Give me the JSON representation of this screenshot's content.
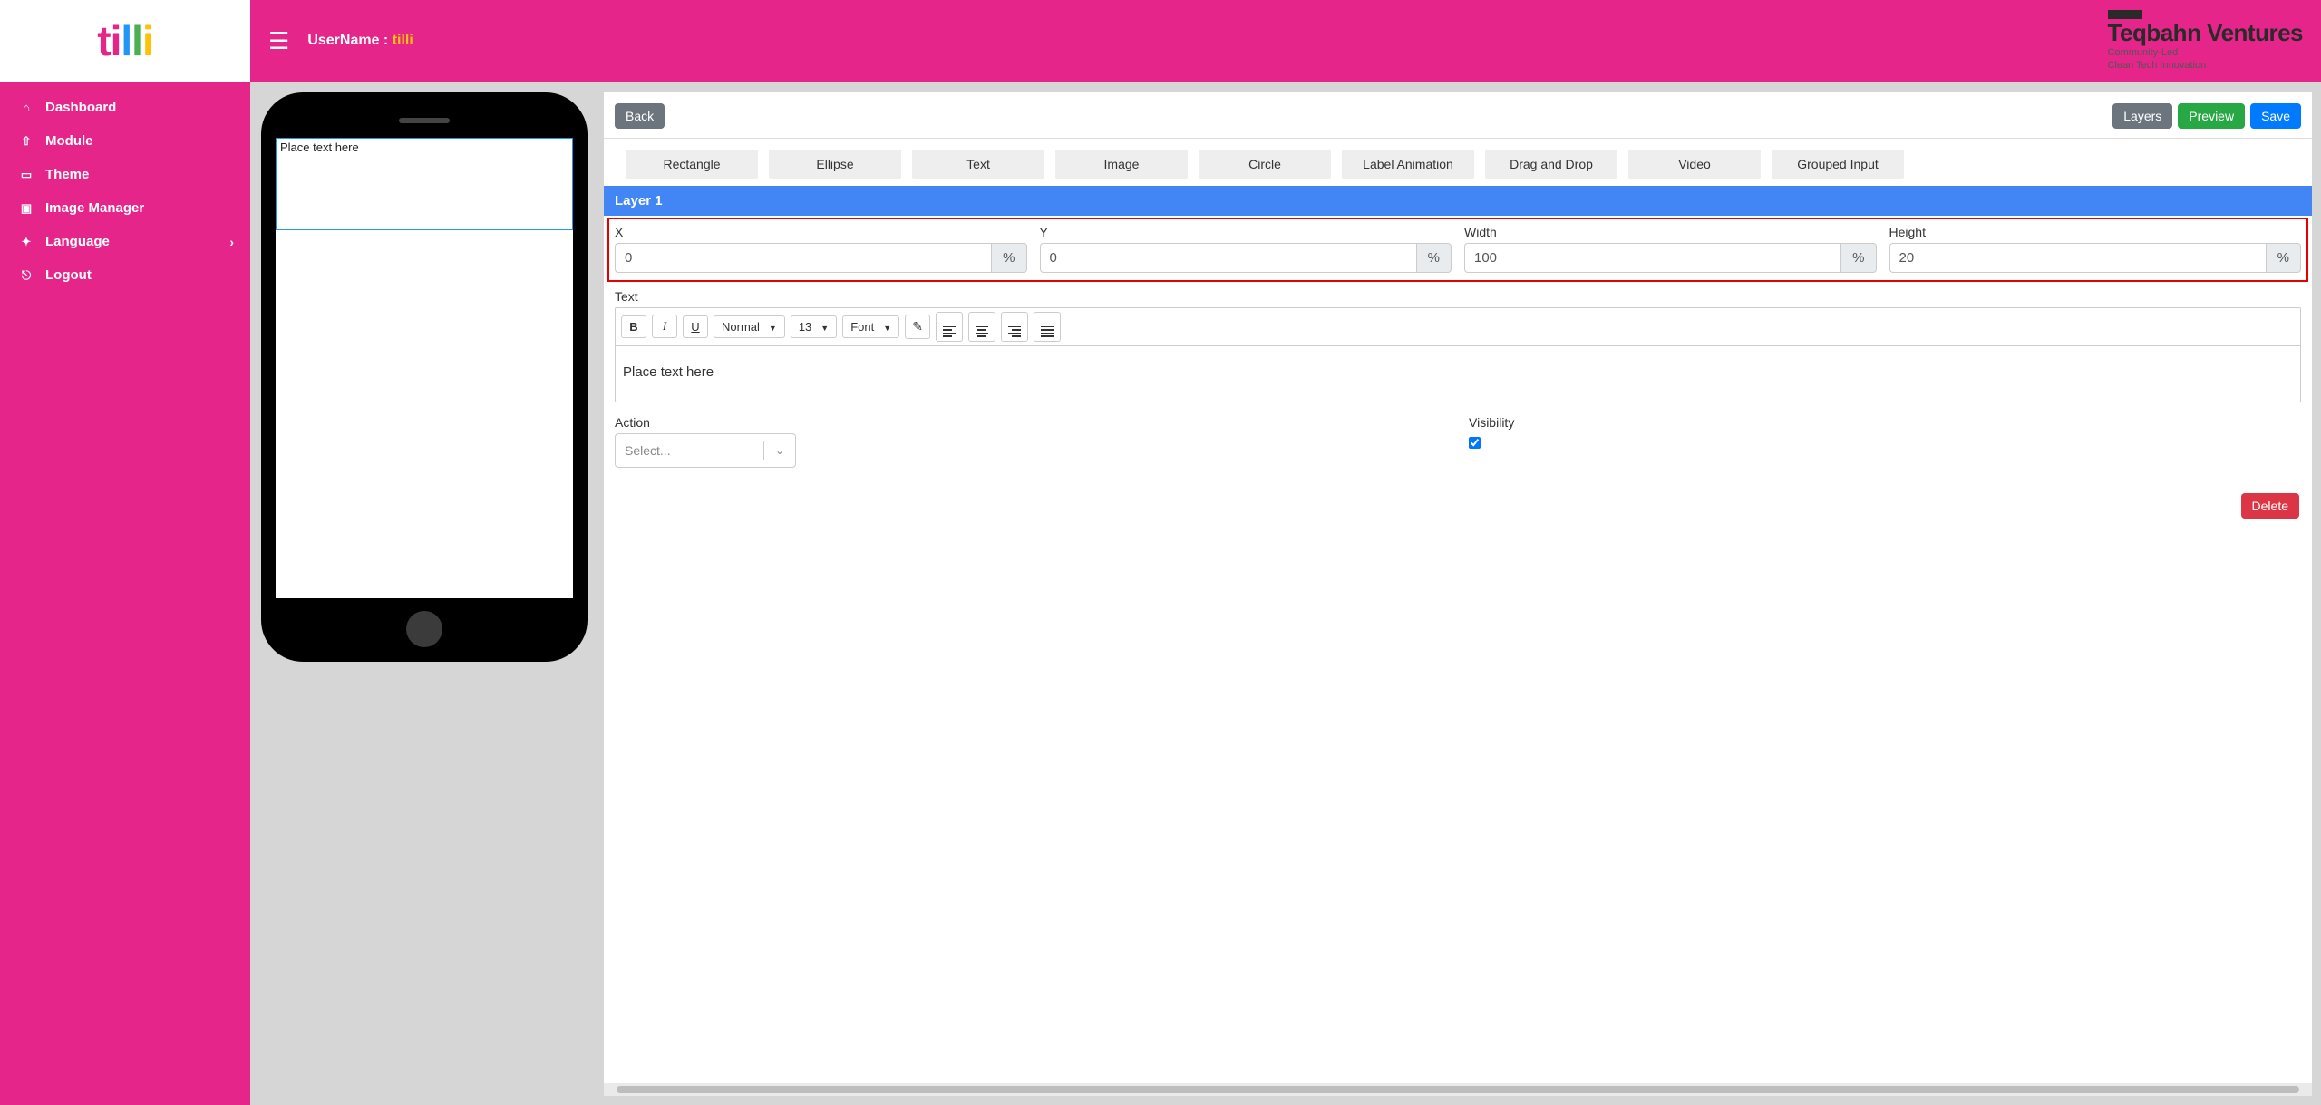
{
  "header": {
    "username_label": "UserName : ",
    "username_value": "tilli",
    "brand_name": "Teqbahn Ventures",
    "brand_sub_line1": "Community-Led",
    "brand_sub_line2": "Clean Tech Innovation"
  },
  "logo": {
    "text": "tilli"
  },
  "sidebar": {
    "items": [
      {
        "icon": "home",
        "label": "Dashboard"
      },
      {
        "icon": "upload",
        "label": "Module"
      },
      {
        "icon": "desktop",
        "label": "Theme"
      },
      {
        "icon": "image",
        "label": "Image Manager"
      },
      {
        "icon": "language",
        "label": "Language",
        "hasSubmenu": true
      },
      {
        "icon": "logout",
        "label": "Logout"
      }
    ]
  },
  "canvas": {
    "layer_text": "Place text here"
  },
  "panel": {
    "back": "Back",
    "layers": "Layers",
    "preview": "Preview",
    "save": "Save",
    "shapes": [
      "Rectangle",
      "Ellipse",
      "Text",
      "Image",
      "Circle",
      "Label Animation",
      "Drag and Drop",
      "Video",
      "Grouped Input"
    ],
    "layer_title": "Layer 1",
    "props": {
      "x": {
        "label": "X",
        "value": "0",
        "unit": "%"
      },
      "y": {
        "label": "Y",
        "value": "0",
        "unit": "%"
      },
      "width": {
        "label": "Width",
        "value": "100",
        "unit": "%"
      },
      "height": {
        "label": "Height",
        "value": "20",
        "unit": "%"
      }
    },
    "text_label": "Text",
    "editor": {
      "style_select": "Normal",
      "size_select": "13",
      "font_select": "Font",
      "content": "Place text here"
    },
    "action": {
      "label": "Action",
      "placeholder": "Select..."
    },
    "visibility": {
      "label": "Visibility",
      "checked": true
    },
    "delete": "Delete"
  }
}
